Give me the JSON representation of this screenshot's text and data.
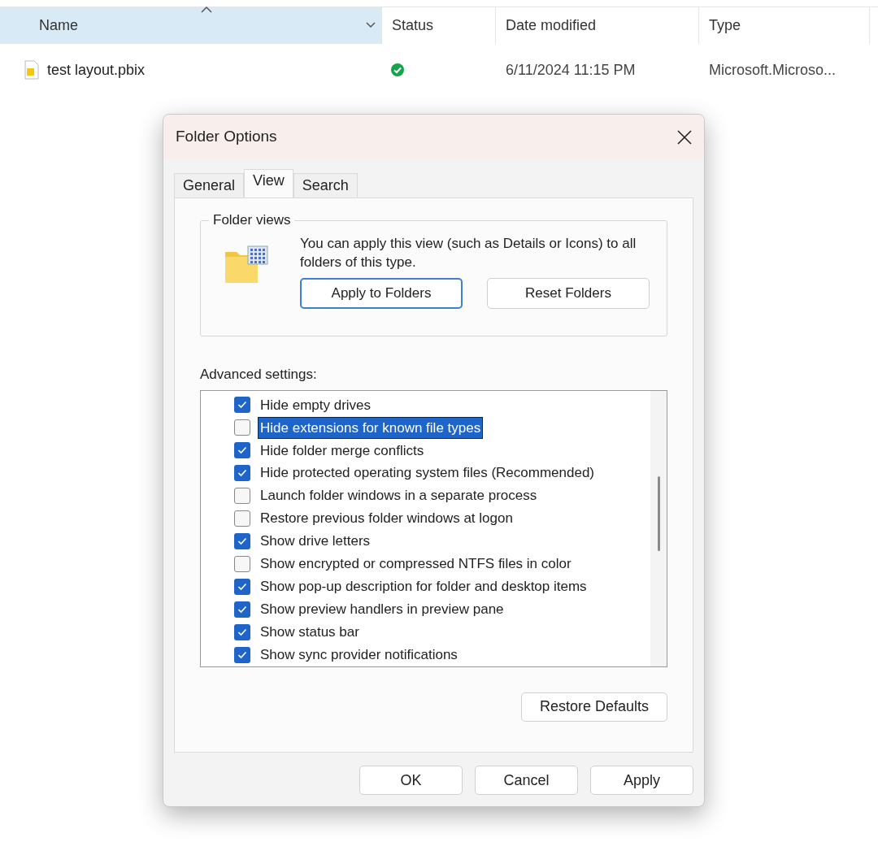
{
  "explorer": {
    "columns": [
      {
        "label": "Name",
        "selected": true
      },
      {
        "label": "Status",
        "selected": false
      },
      {
        "label": "Date modified",
        "selected": false
      },
      {
        "label": "Type",
        "selected": false
      }
    ],
    "rows": [
      {
        "name": "test layout.pbix",
        "synced": true,
        "date": "6/11/2024 11:15 PM",
        "type": "Microsoft.Microso..."
      }
    ]
  },
  "dialog": {
    "title": "Folder Options",
    "tabs": [
      {
        "label": "General",
        "selected": false
      },
      {
        "label": "View",
        "selected": true
      },
      {
        "label": "Search",
        "selected": false
      }
    ],
    "folder_views": {
      "title": "Folder views",
      "description": "You can apply this view (such as Details or Icons) to all folders of this type.",
      "buttons": [
        {
          "label": "Apply to Folders",
          "focused": true
        },
        {
          "label": "Reset Folders",
          "focused": false
        }
      ]
    },
    "advanced": {
      "label": "Advanced settings:",
      "items": [
        {
          "label": "Hide empty drives",
          "checked": true,
          "selected": false
        },
        {
          "label": "Hide extensions for known file types",
          "checked": false,
          "selected": true
        },
        {
          "label": "Hide folder merge conflicts",
          "checked": true,
          "selected": false
        },
        {
          "label": "Hide protected operating system files (Recommended)",
          "checked": true,
          "selected": false
        },
        {
          "label": "Launch folder windows in a separate process",
          "checked": false,
          "selected": false
        },
        {
          "label": "Restore previous folder windows at logon",
          "checked": false,
          "selected": false
        },
        {
          "label": "Show drive letters",
          "checked": true,
          "selected": false
        },
        {
          "label": "Show encrypted or compressed NTFS files in color",
          "checked": false,
          "selected": false
        },
        {
          "label": "Show pop-up description for folder and desktop items",
          "checked": true,
          "selected": false
        },
        {
          "label": "Show preview handlers in preview pane",
          "checked": true,
          "selected": false
        },
        {
          "label": "Show status bar",
          "checked": true,
          "selected": false
        },
        {
          "label": "Show sync provider notifications",
          "checked": true,
          "selected": false
        }
      ]
    },
    "restore_button": "Restore Defaults",
    "buttons": [
      "OK",
      "Cancel",
      "Apply"
    ]
  }
}
